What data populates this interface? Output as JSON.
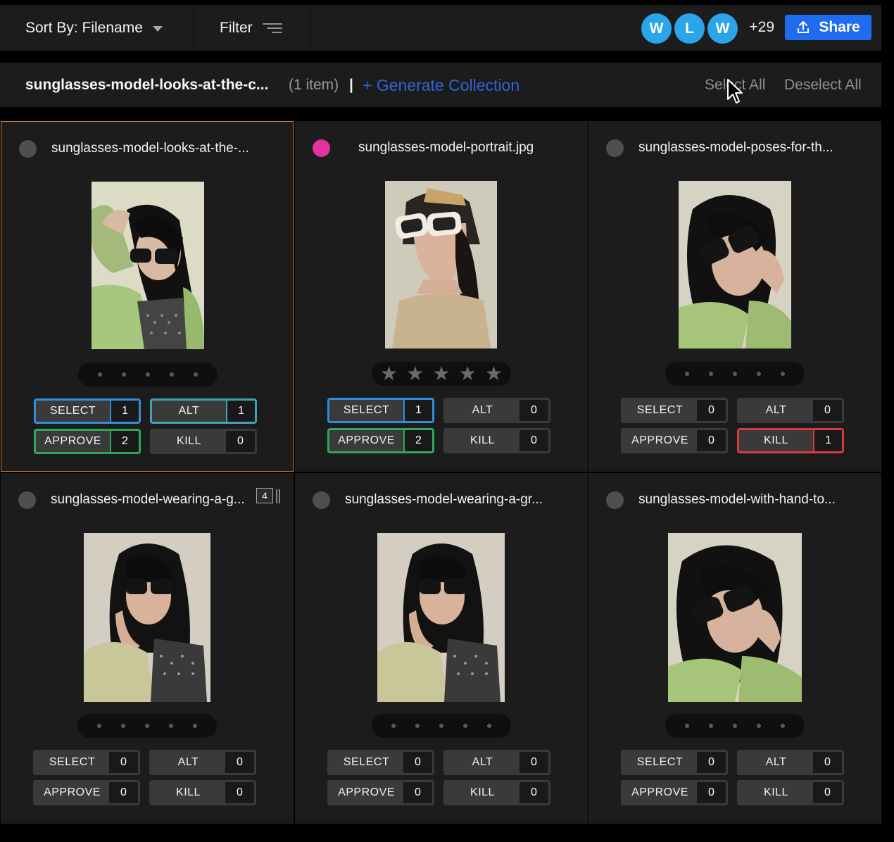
{
  "toolbar": {
    "sort_label": "Sort By: Filename",
    "filter_label": "Filter",
    "avatars": [
      "W",
      "L",
      "W"
    ],
    "more_count": "+29",
    "share_label": "Share",
    "accent": "#1f6cf0"
  },
  "collection": {
    "name": "sunglasses-model-looks-at-the-c...",
    "count": "(1 item)",
    "separator": "|",
    "generate_label": "+ Generate Collection",
    "select_all": "Select All",
    "deselect_all": "Deselect All"
  },
  "cards": [
    {
      "filename": "sunglasses-model-looks-at-the-...",
      "checked": false,
      "rating": 0,
      "votes": {
        "select": "1",
        "alt": "1",
        "approve": "2",
        "kill": "0"
      },
      "labels": {
        "select": "SELECT",
        "alt": "ALT",
        "approve": "APPROVE",
        "kill": "KILL"
      }
    },
    {
      "filename": "sunglasses-model-portrait.jpg",
      "checked": true,
      "rating": 0,
      "votes": {
        "select": "1",
        "alt": "0",
        "approve": "2",
        "kill": "0"
      },
      "labels": {
        "select": "SELECT",
        "alt": "ALT",
        "approve": "APPROVE",
        "kill": "KILL"
      }
    },
    {
      "filename": "sunglasses-model-poses-for-th...",
      "checked": false,
      "rating": 0,
      "votes": {
        "select": "0",
        "alt": "0",
        "approve": "0",
        "kill": "1"
      },
      "labels": {
        "select": "SELECT",
        "alt": "ALT",
        "approve": "APPROVE",
        "kill": "KILL"
      }
    },
    {
      "filename": "sunglasses-model-wearing-a-g...",
      "checked": false,
      "stack_count": "4",
      "rating": 0,
      "votes": {
        "select": "0",
        "alt": "0",
        "approve": "0",
        "kill": "0"
      },
      "labels": {
        "select": "SELECT",
        "alt": "ALT",
        "approve": "APPROVE",
        "kill": "KILL"
      }
    },
    {
      "filename": "sunglasses-model-wearing-a-gr...",
      "checked": false,
      "rating": 0,
      "votes": {
        "select": "0",
        "alt": "0",
        "approve": "0",
        "kill": "0"
      },
      "labels": {
        "select": "SELECT",
        "alt": "ALT",
        "approve": "APPROVE",
        "kill": "KILL"
      }
    },
    {
      "filename": "sunglasses-model-with-hand-to...",
      "checked": false,
      "rating": 0,
      "votes": {
        "select": "0",
        "alt": "0",
        "approve": "0",
        "kill": "0"
      },
      "labels": {
        "select": "SELECT",
        "alt": "ALT",
        "approve": "APPROVE",
        "kill": "KILL"
      }
    }
  ],
  "colors": {
    "label_checked": "#e0339c",
    "select_border": "#2f8fdc",
    "alt_border": "#3fa3b8",
    "approve_border": "#2fa85b",
    "kill_border": "#d63a3a",
    "active_card_border": "#e07a2c"
  }
}
